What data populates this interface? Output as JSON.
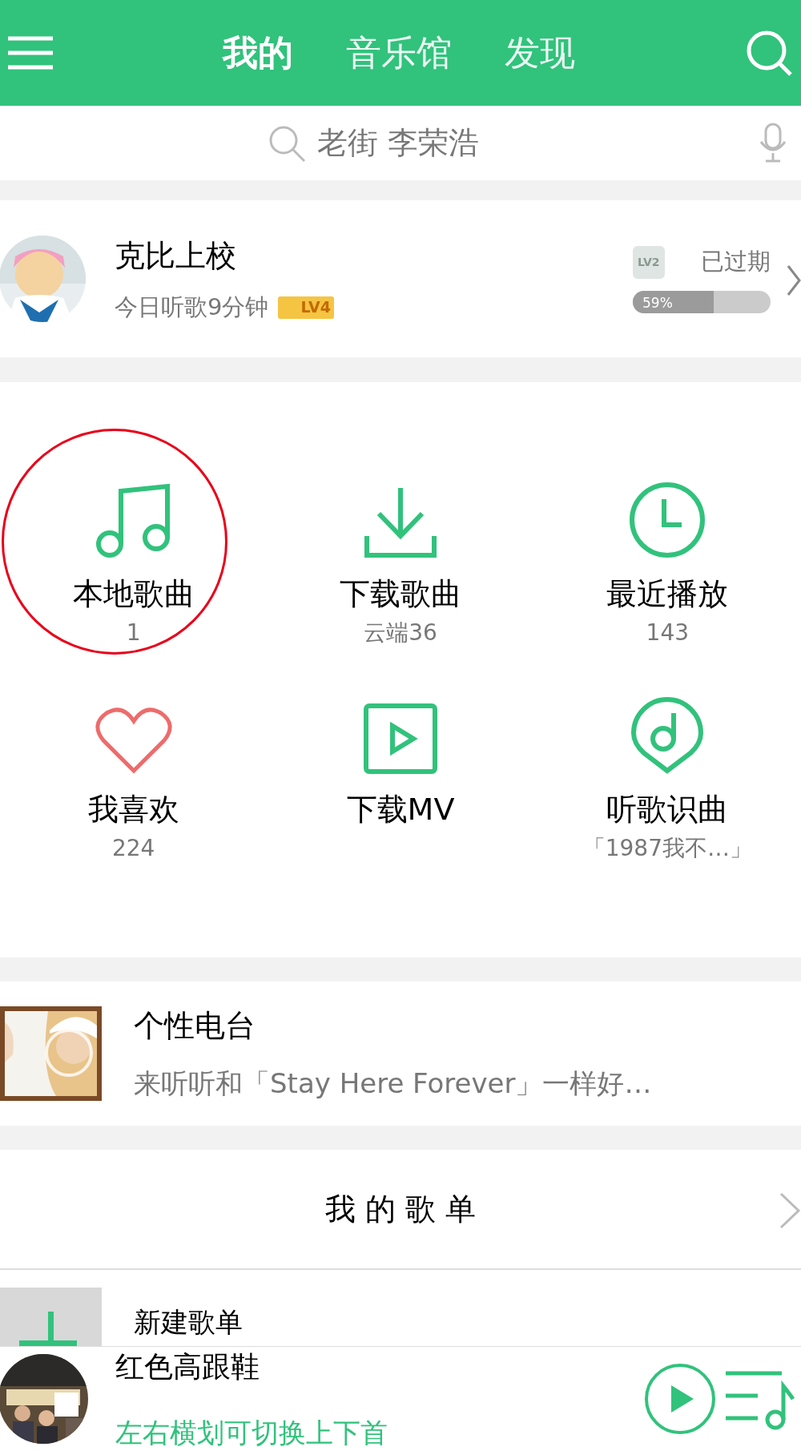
{
  "top_bar": {
    "tabs": [
      {
        "label": "我的",
        "selected": true
      },
      {
        "label": "音乐馆",
        "selected": false
      },
      {
        "label": "发现",
        "selected": false
      }
    ]
  },
  "search": {
    "placeholder": "老街 李荣浩"
  },
  "profile": {
    "name": "克比上校",
    "listening_today": "今日听歌9分钟",
    "music_level": "LV4",
    "vip_level": "LV2",
    "vip_status": "已过期",
    "vip_progress": {
      "level": 0.59,
      "reading": "59%"
    }
  },
  "shortcuts": [
    {
      "kind": "note",
      "label": "本地歌曲",
      "count": "1",
      "circled": true
    },
    {
      "kind": "download",
      "label": "下载歌曲",
      "count": "云端36",
      "circled": false
    },
    {
      "kind": "clock",
      "label": "最近播放",
      "count": "143",
      "circled": false
    },
    {
      "kind": "heart",
      "label": "我喜欢",
      "count": "224",
      "circled": false
    },
    {
      "kind": "video",
      "label": "下载MV",
      "circled": false
    },
    {
      "kind": "recognize",
      "label": "听歌识曲",
      "count": "「1987我不…」",
      "circled": false
    }
  ],
  "radio": {
    "title": "个性电台",
    "subtitle": "来听听和「Stay Here Forever」一样好…"
  },
  "playlists": {
    "title": "我 的 歌 单",
    "new_playlist": "新建歌单"
  },
  "now_playing": {
    "title": "红色高跟鞋",
    "hint": "左右横划可切换上下首"
  }
}
